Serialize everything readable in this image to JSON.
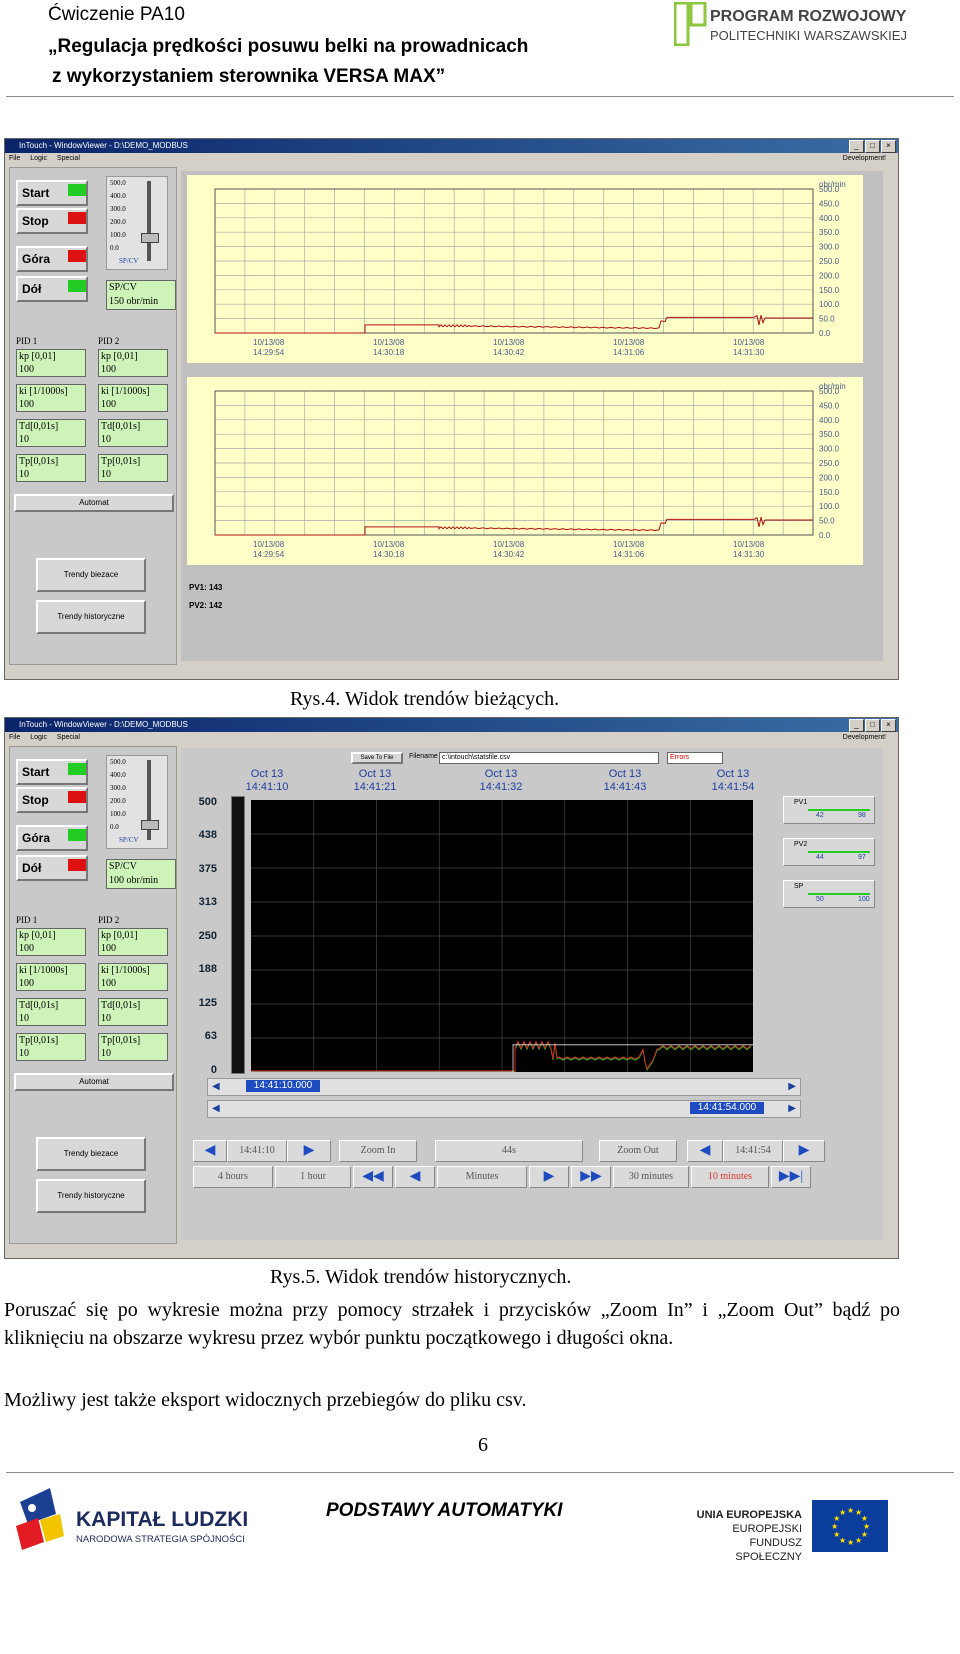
{
  "header": {
    "line1": "Ćwiczenie PA10",
    "line2": "„Regulacja prędkości posuwu belki na prowadnicach",
    "line3": "z wykorzystaniem sterownika VERSA MAX”",
    "logo_line1": "PROGRAM ROZWOJOWY",
    "logo_line2": "POLITECHNIKI WARSZAWSKIEJ"
  },
  "window": {
    "title": "InTouch - WindowViewer - D:\\DEMO_MODBUS",
    "menu": [
      "File",
      "Logic",
      "Special"
    ],
    "menu_right": "Development!",
    "start": "Start",
    "stop": "Stop",
    "up": "Góra",
    "down": "Dół",
    "slider_ticks": [
      "500.0",
      "400.0",
      "300.0",
      "200.0",
      "100.0",
      "0.0"
    ],
    "slider_label": "SP/CV",
    "spcv_label": "SP/CV",
    "pid1": "PID 1",
    "pid2": "PID 2",
    "kp": "kp [0,01]",
    "ki": "ki [1/1000s]",
    "td": "Td[0,01s]",
    "tp": "Tp[0,01s]",
    "v100": "100",
    "v10": "10",
    "automat": "Automat",
    "trendy_biezace": "Trendy biezace",
    "trendy_historyczne": "Trendy historyczne",
    "colors": {
      "green": "#22cc22",
      "red": "#dd1111",
      "field": "#cdf3b9"
    }
  },
  "fig1": {
    "spcv_value": "150 obr/min",
    "pv1": "PV1: 143",
    "pv2": "PV2: 142",
    "unit": "obr/min",
    "y_ticks": [
      "500.0",
      "450.0",
      "400.0",
      "350.0",
      "300.0",
      "250.0",
      "200.0",
      "150.0",
      "100.0",
      "50.0",
      "0.0"
    ],
    "x_dates": [
      "10/13/08",
      "10/13/08",
      "10/13/08",
      "10/13/08",
      "10/13/08"
    ],
    "x_times": [
      "14:29:54",
      "14:30:18",
      "14:30:42",
      "14:31:06",
      "14:31:30"
    ],
    "caption": "Rys.4. Widok trendów bieżących."
  },
  "fig2": {
    "spcv_value": "100 obr/min",
    "save_to_file": "Save To File",
    "filename_label": "Filename",
    "filename": "c:\\intouch\\statsfile.csv",
    "errors": "Errors",
    "top_dates": [
      "Oct 13",
      "Oct 13",
      "Oct 13",
      "Oct 13",
      "Oct 13"
    ],
    "top_times": [
      "14:41:10",
      "14:41:21",
      "14:41:32",
      "14:41:43",
      "14:41:54"
    ],
    "y_ticks": [
      "500",
      "438",
      "375",
      "313",
      "250",
      "188",
      "125",
      "63",
      "0"
    ],
    "start_time": "14:41:10.000",
    "end_time": "14:41:54.000",
    "pv_boxes": [
      {
        "label": "PV1",
        "v1": "42",
        "v2": "98"
      },
      {
        "label": "PV2",
        "v1": "44",
        "v2": "97"
      },
      {
        "label": "SP",
        "v1": "50",
        "v2": "100"
      }
    ],
    "nav": {
      "left_time": "14:41:10",
      "zoom_in": "Zoom In",
      "duration": "44s",
      "zoom_out": "Zoom Out",
      "right_time": "14:41:54",
      "four_hours": "4 hours",
      "one_hour": "1 hour",
      "minutes": "Minutes",
      "thirty_minutes": "30 minutes",
      "ten_minutes": "10 minutes"
    },
    "caption": "Rys.5. Widok trendów historycznych."
  },
  "text": {
    "para1": "Poruszać się po wykresie można przy pomocy strzałek i przycisków „Zoom In” i „Zoom Out” bądź po kliknięciu na obszarze wykresu przez wybór punktu początkowego i długości okna.",
    "para2": "Możliwy jest także eksport widocznych przebiegów do pliku csv.",
    "page_number": "6"
  },
  "footer": {
    "kl_title": "KAPITAŁ LUDZKI",
    "kl_sub": "NARODOWA STRATEGIA SPÓJNOŚCI",
    "center": "PODSTAWY AUTOMATYKI",
    "eu1": "UNIA EUROPEJSKA",
    "eu2": "EUROPEJSKI",
    "eu3": "FUNDUSZ SPOŁECZNY"
  }
}
